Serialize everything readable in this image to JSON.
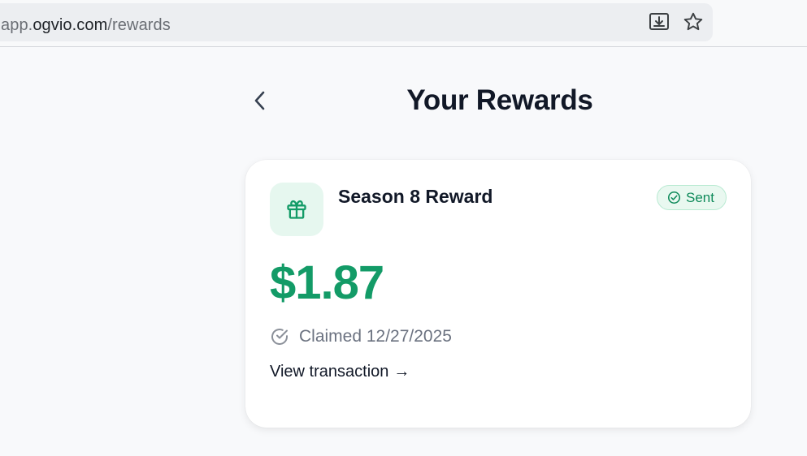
{
  "browser": {
    "url_prefix": "app.",
    "url_host": "ogvio.com",
    "url_path": "/rewards",
    "icons": [
      "install-app-icon",
      "bookmark-star-icon"
    ]
  },
  "page": {
    "title": "Your Rewards",
    "back_icon": "chevron-left-icon"
  },
  "reward": {
    "name": "Season 8 Reward",
    "status": "Sent",
    "amount": "$1.87",
    "claimed_text": "Claimed 12/27/2025",
    "view_link_text": "View transaction",
    "view_link_arrow": "→",
    "icons": [
      "gift-icon",
      "check-circle-icon"
    ]
  },
  "colors": {
    "accent_green": "#139b67",
    "badge_bg": "#e9f8f0",
    "gift_tile_bg": "#e6f7ef",
    "title_text": "#111827",
    "muted_text": "#6b7280"
  }
}
